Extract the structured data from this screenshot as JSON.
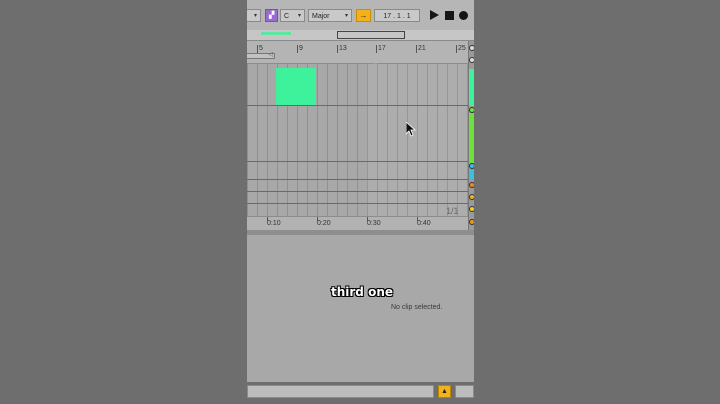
{
  "control_bar": {
    "root_key": "C",
    "scale_name": "Major",
    "scale_icon": "scale-mode-icon",
    "follow_icon": "follow-arrow-icon",
    "position": "17 .  1 .  1",
    "play_icon": "play-icon",
    "stop_icon": "stop-icon",
    "record_icon": "record-icon"
  },
  "ruler": {
    "bars": [
      "5",
      "9",
      "13",
      "17",
      "21",
      "25"
    ]
  },
  "timeline": {
    "labels": [
      "0:10",
      "0:20",
      "0:30",
      "0:40"
    ]
  },
  "arrangement": {
    "page_indicator": "1/1",
    "clip_color": "#3df29a"
  },
  "tracks": {
    "colors": [
      "#3df29a",
      "#6ee03a",
      "#39bfe0",
      "#f28a1b",
      "#f2b21b",
      "#f2d21b",
      "#f2961b"
    ]
  },
  "detail": {
    "empty_text": "No clip selected."
  },
  "caption": {
    "text": "third one"
  },
  "status": {
    "toggle_icon": "triangle-up-icon"
  }
}
